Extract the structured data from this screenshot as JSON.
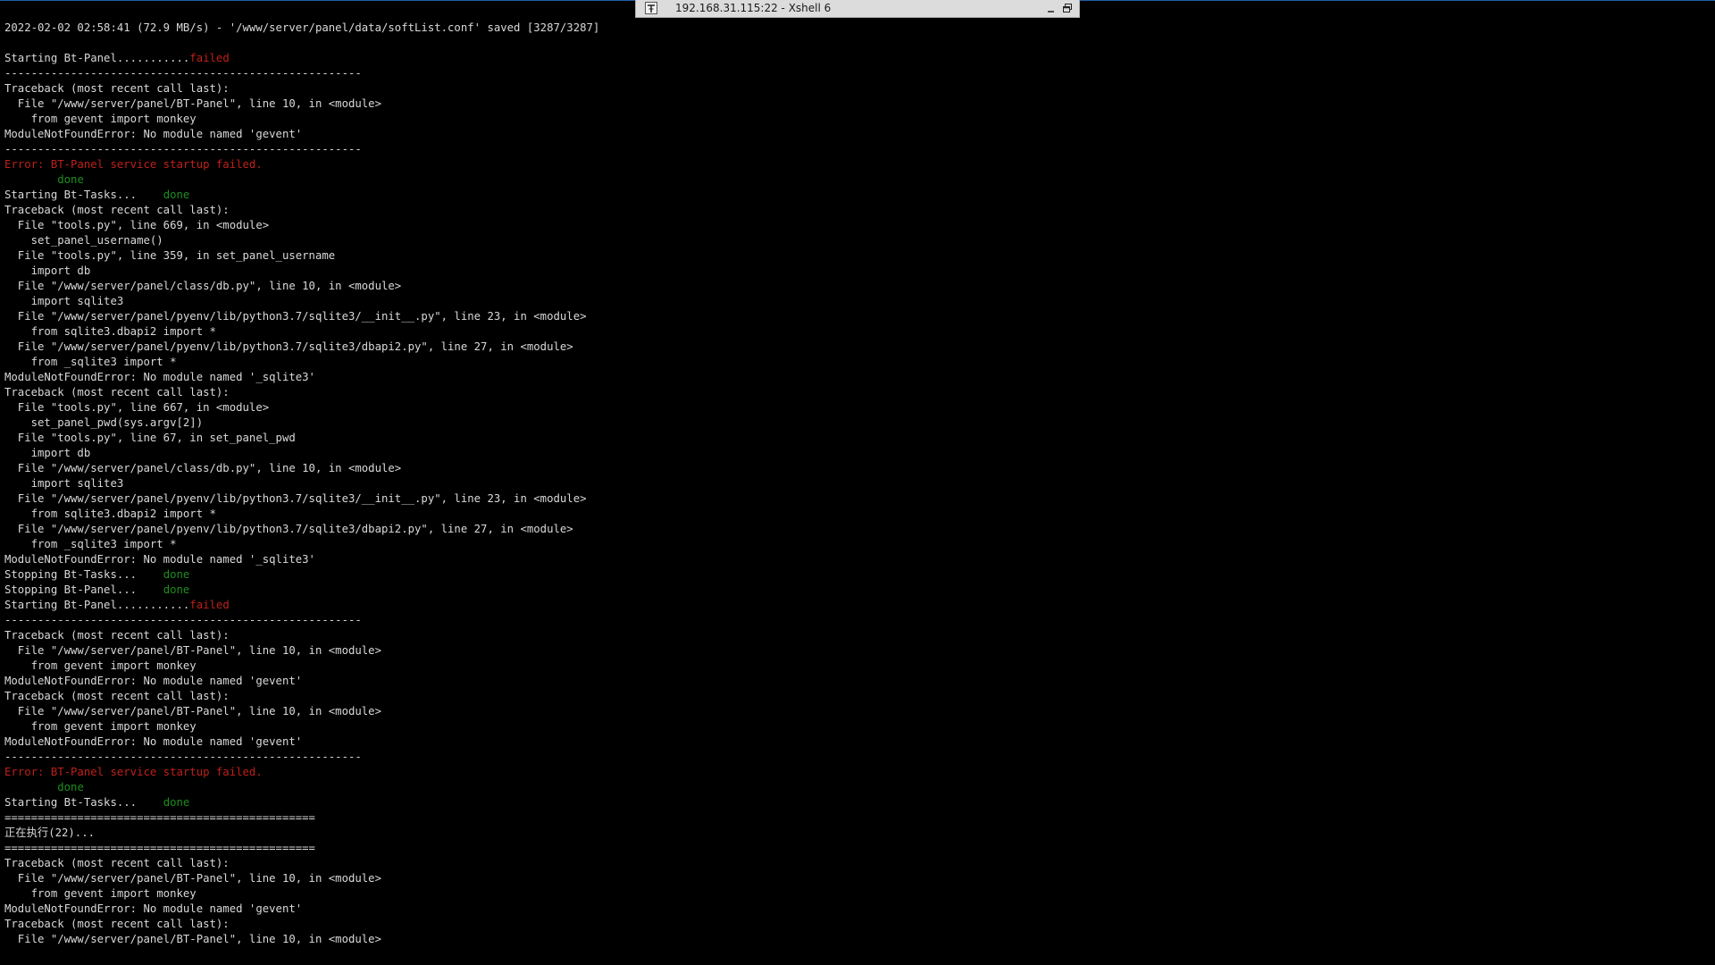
{
  "window": {
    "title": "192.168.31.115:22 - Xshell 6"
  },
  "icons": {
    "pin": "pin-icon",
    "minimize": "minimize-icon",
    "restore": "restore-icon"
  },
  "colors": {
    "background": "#000000",
    "text": "#d9d9d9",
    "error": "#c0201a",
    "success": "#1e8e1e",
    "tab_background": "#dcdcdc"
  },
  "terminal": {
    "lines": [
      [
        {
          "text": "2022-02-02 02:58:41 (72.9 MB/s) - '/www/server/panel/data/softList.conf' saved [3287/3287]",
          "color": "default"
        }
      ],
      [
        {
          "text": "",
          "color": "default"
        }
      ],
      [
        {
          "text": "Starting Bt-Panel...........",
          "color": "default"
        },
        {
          "text": "failed",
          "color": "red"
        }
      ],
      [
        {
          "text": "------------------------------------------------------",
          "color": "default"
        }
      ],
      [
        {
          "text": "Traceback (most recent call last):",
          "color": "default"
        }
      ],
      [
        {
          "text": "  File \"/www/server/panel/BT-Panel\", line 10, in <module>",
          "color": "default"
        }
      ],
      [
        {
          "text": "    from gevent import monkey",
          "color": "default"
        }
      ],
      [
        {
          "text": "ModuleNotFoundError: No module named 'gevent'",
          "color": "default"
        }
      ],
      [
        {
          "text": "------------------------------------------------------",
          "color": "default"
        }
      ],
      [
        {
          "text": "Error: BT-Panel service startup failed.",
          "color": "red"
        }
      ],
      [
        {
          "text": "        ",
          "color": "default"
        },
        {
          "text": "done",
          "color": "green"
        }
      ],
      [
        {
          "text": "Starting Bt-Tasks...    ",
          "color": "default"
        },
        {
          "text": "done",
          "color": "green"
        }
      ],
      [
        {
          "text": "Traceback (most recent call last):",
          "color": "default"
        }
      ],
      [
        {
          "text": "  File \"tools.py\", line 669, in <module>",
          "color": "default"
        }
      ],
      [
        {
          "text": "    set_panel_username()",
          "color": "default"
        }
      ],
      [
        {
          "text": "  File \"tools.py\", line 359, in set_panel_username",
          "color": "default"
        }
      ],
      [
        {
          "text": "    import db",
          "color": "default"
        }
      ],
      [
        {
          "text": "  File \"/www/server/panel/class/db.py\", line 10, in <module>",
          "color": "default"
        }
      ],
      [
        {
          "text": "    import sqlite3",
          "color": "default"
        }
      ],
      [
        {
          "text": "  File \"/www/server/panel/pyenv/lib/python3.7/sqlite3/__init__.py\", line 23, in <module>",
          "color": "default"
        }
      ],
      [
        {
          "text": "    from sqlite3.dbapi2 import *",
          "color": "default"
        }
      ],
      [
        {
          "text": "  File \"/www/server/panel/pyenv/lib/python3.7/sqlite3/dbapi2.py\", line 27, in <module>",
          "color": "default"
        }
      ],
      [
        {
          "text": "    from _sqlite3 import *",
          "color": "default"
        }
      ],
      [
        {
          "text": "ModuleNotFoundError: No module named '_sqlite3'",
          "color": "default"
        }
      ],
      [
        {
          "text": "Traceback (most recent call last):",
          "color": "default"
        }
      ],
      [
        {
          "text": "  File \"tools.py\", line 667, in <module>",
          "color": "default"
        }
      ],
      [
        {
          "text": "    set_panel_pwd(sys.argv[2])",
          "color": "default"
        }
      ],
      [
        {
          "text": "  File \"tools.py\", line 67, in set_panel_pwd",
          "color": "default"
        }
      ],
      [
        {
          "text": "    import db",
          "color": "default"
        }
      ],
      [
        {
          "text": "  File \"/www/server/panel/class/db.py\", line 10, in <module>",
          "color": "default"
        }
      ],
      [
        {
          "text": "    import sqlite3",
          "color": "default"
        }
      ],
      [
        {
          "text": "  File \"/www/server/panel/pyenv/lib/python3.7/sqlite3/__init__.py\", line 23, in <module>",
          "color": "default"
        }
      ],
      [
        {
          "text": "    from sqlite3.dbapi2 import *",
          "color": "default"
        }
      ],
      [
        {
          "text": "  File \"/www/server/panel/pyenv/lib/python3.7/sqlite3/dbapi2.py\", line 27, in <module>",
          "color": "default"
        }
      ],
      [
        {
          "text": "    from _sqlite3 import *",
          "color": "default"
        }
      ],
      [
        {
          "text": "ModuleNotFoundError: No module named '_sqlite3'",
          "color": "default"
        }
      ],
      [
        {
          "text": "Stopping Bt-Tasks...    ",
          "color": "default"
        },
        {
          "text": "done",
          "color": "green"
        }
      ],
      [
        {
          "text": "Stopping Bt-Panel...    ",
          "color": "default"
        },
        {
          "text": "done",
          "color": "green"
        }
      ],
      [
        {
          "text": "Starting Bt-Panel...........",
          "color": "default"
        },
        {
          "text": "failed",
          "color": "red"
        }
      ],
      [
        {
          "text": "------------------------------------------------------",
          "color": "default"
        }
      ],
      [
        {
          "text": "Traceback (most recent call last):",
          "color": "default"
        }
      ],
      [
        {
          "text": "  File \"/www/server/panel/BT-Panel\", line 10, in <module>",
          "color": "default"
        }
      ],
      [
        {
          "text": "    from gevent import monkey",
          "color": "default"
        }
      ],
      [
        {
          "text": "ModuleNotFoundError: No module named 'gevent'",
          "color": "default"
        }
      ],
      [
        {
          "text": "Traceback (most recent call last):",
          "color": "default"
        }
      ],
      [
        {
          "text": "  File \"/www/server/panel/BT-Panel\", line 10, in <module>",
          "color": "default"
        }
      ],
      [
        {
          "text": "    from gevent import monkey",
          "color": "default"
        }
      ],
      [
        {
          "text": "ModuleNotFoundError: No module named 'gevent'",
          "color": "default"
        }
      ],
      [
        {
          "text": "------------------------------------------------------",
          "color": "default"
        }
      ],
      [
        {
          "text": "Error: BT-Panel service startup failed.",
          "color": "red"
        }
      ],
      [
        {
          "text": "        ",
          "color": "default"
        },
        {
          "text": "done",
          "color": "green"
        }
      ],
      [
        {
          "text": "Starting Bt-Tasks...    ",
          "color": "default"
        },
        {
          "text": "done",
          "color": "green"
        }
      ],
      [
        {
          "text": "===============================================",
          "color": "default"
        }
      ],
      [
        {
          "text": "正在执行(22)...",
          "color": "default"
        }
      ],
      [
        {
          "text": "===============================================",
          "color": "default"
        }
      ],
      [
        {
          "text": "Traceback (most recent call last):",
          "color": "default"
        }
      ],
      [
        {
          "text": "  File \"/www/server/panel/BT-Panel\", line 10, in <module>",
          "color": "default"
        }
      ],
      [
        {
          "text": "    from gevent import monkey",
          "color": "default"
        }
      ],
      [
        {
          "text": "ModuleNotFoundError: No module named 'gevent'",
          "color": "default"
        }
      ],
      [
        {
          "text": "Traceback (most recent call last):",
          "color": "default"
        }
      ],
      [
        {
          "text": "  File \"/www/server/panel/BT-Panel\", line 10, in <module>",
          "color": "default"
        }
      ]
    ]
  }
}
